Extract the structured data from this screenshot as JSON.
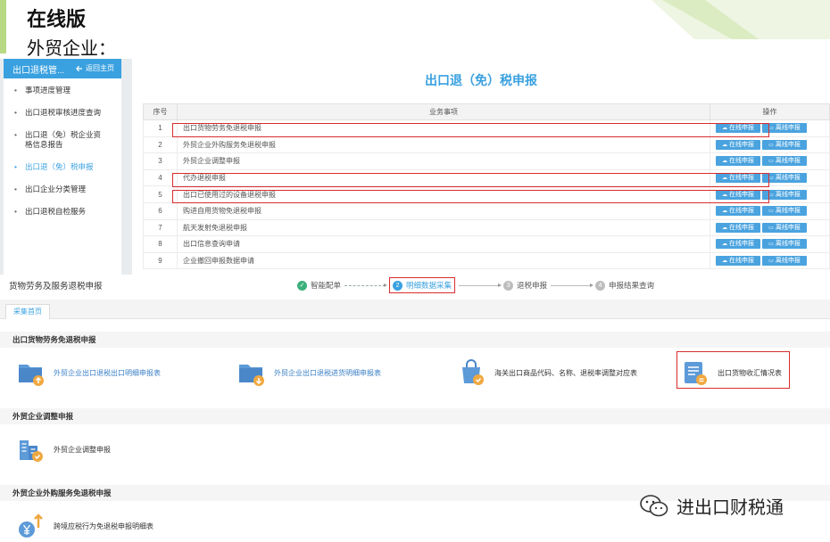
{
  "slide": {
    "title": "在线版",
    "subtitle": "外贸企业："
  },
  "sidebar": {
    "title": "出口退税管...",
    "back_label": "返回主页",
    "items": [
      {
        "label": "事项进度管理"
      },
      {
        "label": "出口退税审核进度查询"
      },
      {
        "label": "出口退（免）税企业资格信息报告"
      },
      {
        "label": "出口退（免）税申报"
      },
      {
        "label": "出口企业分类管理"
      },
      {
        "label": "出口退税自检服务"
      }
    ]
  },
  "declaration": {
    "title": "出口退（免）税申报",
    "headers": {
      "no": "序号",
      "item": "业务事项",
      "ops": "操作"
    },
    "online_label": "在线申报",
    "offline_label": "离线申报",
    "rows": [
      {
        "no": "1",
        "name": "出口货物劳务免退税申报"
      },
      {
        "no": "2",
        "name": "外贸企业外购服务免退税申报"
      },
      {
        "no": "3",
        "name": "外贸企业调整申报"
      },
      {
        "no": "4",
        "name": "代办退税申报"
      },
      {
        "no": "5",
        "name": "出口已使用过的设备退税申报"
      },
      {
        "no": "6",
        "name": "购进自用货物免退税申报"
      },
      {
        "no": "7",
        "name": "航天发射免退税申报"
      },
      {
        "no": "8",
        "name": "出口信息查询申请"
      },
      {
        "no": "9",
        "name": "企业撤回申报数据申请"
      }
    ]
  },
  "collect": {
    "title": "货物劳务及服务退税申报",
    "steps": [
      {
        "num": "1",
        "label": "智能配单"
      },
      {
        "num": "2",
        "label": "明细数据采集"
      },
      {
        "num": "3",
        "label": "退税申报"
      },
      {
        "num": "4",
        "label": "申报结果查询"
      }
    ],
    "tab_label": "采集首页",
    "sections": [
      {
        "title": "出口货物劳务免退税申报",
        "modules": [
          {
            "label": "外贸企业出口退税出口明细申报表"
          },
          {
            "label": "外贸企业出口退税进货明细申报表"
          },
          {
            "label": "海关出口商品代码、名称、退税率调整对应表"
          },
          {
            "label": "出口货物收汇情况表"
          }
        ]
      },
      {
        "title": "外贸企业调整申报",
        "modules": [
          {
            "label": "外贸企业调整申报"
          }
        ]
      },
      {
        "title": "外贸企业外购服务免退税申报",
        "modules": [
          {
            "label": "跨境应税行为免退税申报明细表"
          }
        ]
      }
    ]
  },
  "watermark": {
    "text": "进出口财税通"
  },
  "colors": {
    "accent_blue": "#3aa1e0",
    "slide_green": "#b7d984",
    "highlight_red": "#d92c2c",
    "step_done": "#3cb07b"
  }
}
